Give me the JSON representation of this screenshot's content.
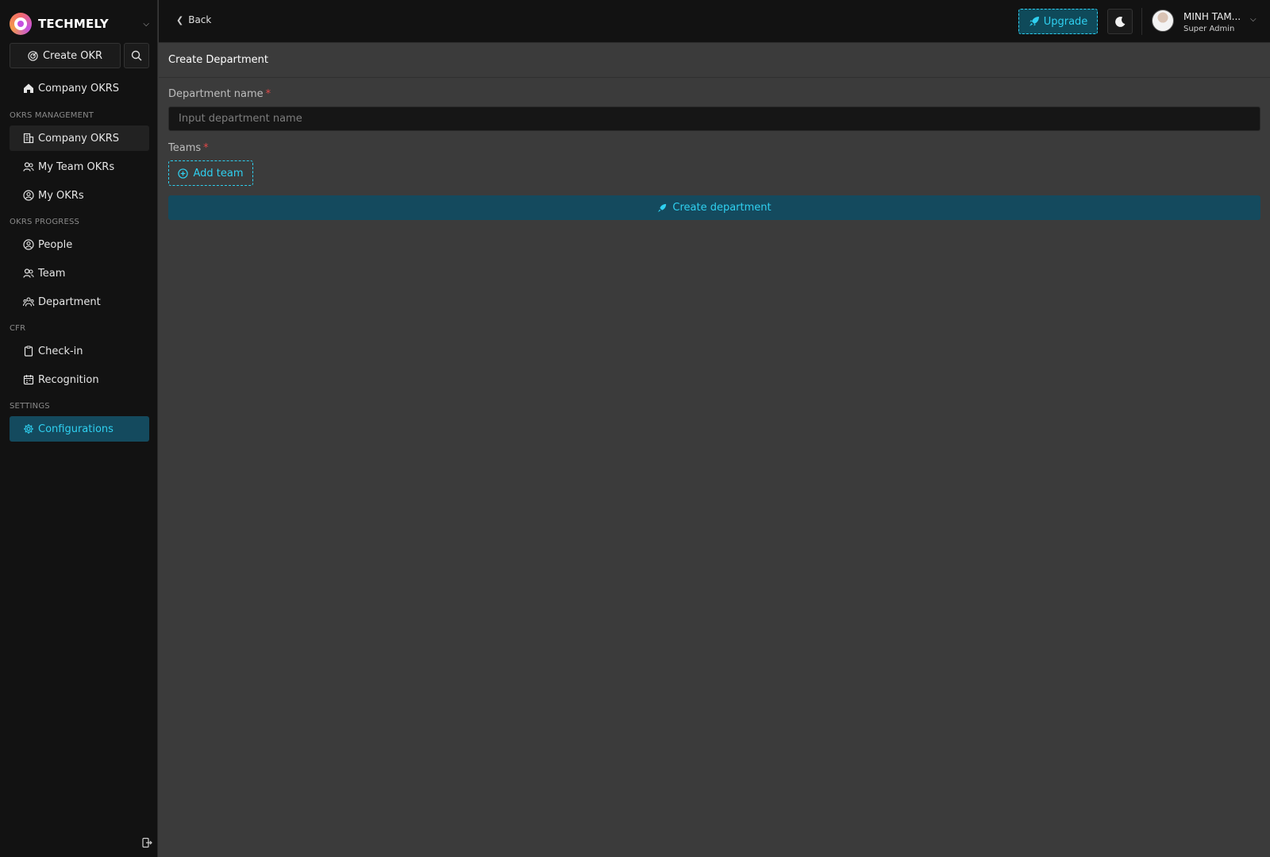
{
  "brand": {
    "name": "TECHMELY"
  },
  "sidebar": {
    "create_okr_label": "Create OKR",
    "home_item": "Company OKRS",
    "sections": {
      "okrs_management": "OKRS MANAGEMENT",
      "okrs_progress": "OKRS PROGRESS",
      "cfr": "CFR",
      "settings": "SETTINGS"
    },
    "items": {
      "company_okrs": "Company OKRS",
      "my_team_okrs": "My Team OKRs",
      "my_okrs": "My OKRs",
      "people": "People",
      "team": "Team",
      "department": "Department",
      "check_in": "Check-in",
      "recognition": "Recognition",
      "configurations": "Configurations"
    }
  },
  "header": {
    "back_label": "Back",
    "upgrade_label": "Upgrade",
    "user": {
      "name": "MINH TAM...",
      "role": "Super Admin"
    }
  },
  "page": {
    "title": "Create Department",
    "department_label": "Department name",
    "department_placeholder": "Input department name",
    "teams_label": "Teams",
    "required_mark": "*",
    "add_team_label": "Add team",
    "submit_label": "Create department"
  },
  "colors": {
    "accent": "#2fd0f0",
    "accent_bg": "#144a5e",
    "required": "#e04848",
    "sidebar_bg": "#121212",
    "content_bg": "#3b3b3b"
  }
}
